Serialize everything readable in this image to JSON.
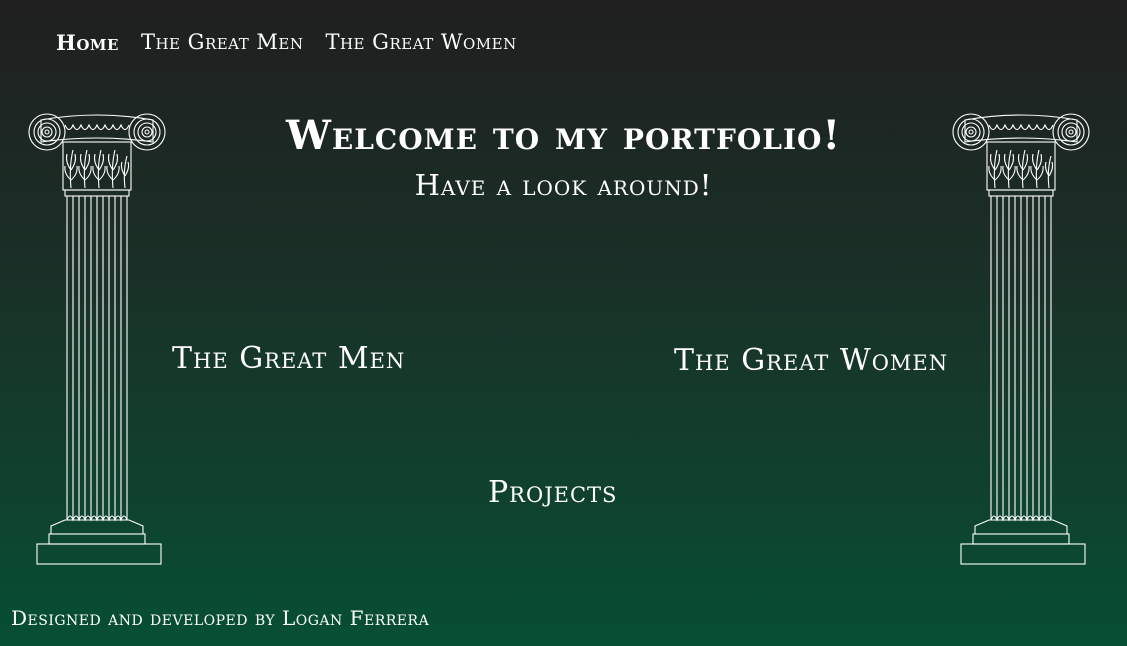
{
  "nav": {
    "items": [
      {
        "label": "Home",
        "active": true
      },
      {
        "label": "The Great Men",
        "active": false
      },
      {
        "label": "The Great Women",
        "active": false
      }
    ]
  },
  "hero": {
    "title": "Welcome to my portfolio!",
    "subtitle": "Have a look around!"
  },
  "links": {
    "men": "The Great Men",
    "women": "The Great Women",
    "projects": "Projects"
  },
  "footer": {
    "text": "Designed and developed by Logan Ferrera"
  },
  "theme": {
    "text_color": "#ffffff",
    "gradient_top": "#1f1f1f",
    "gradient_bottom": "#064f33"
  },
  "icons": [
    "ionic-column-icon"
  ]
}
